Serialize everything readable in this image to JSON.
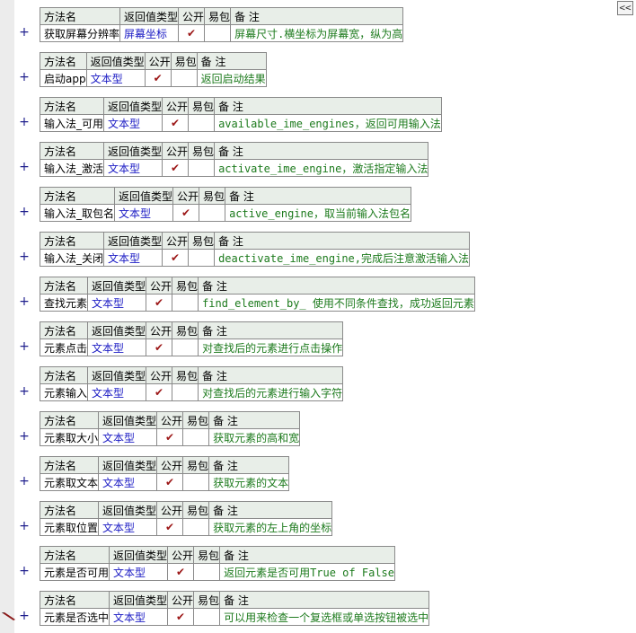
{
  "ui": {
    "collapse_label": "<<",
    "plus_label": "+",
    "check_mark": "✔"
  },
  "header": {
    "name": "方法名",
    "return_type": "返回值类型",
    "public": "公开",
    "easy_pack": "易包",
    "note": "备 注"
  },
  "methods": [
    {
      "name": "获取屏幕分辨率",
      "return_type": "屏幕坐标",
      "note": "屏幕尺寸.横坐标为屏幕宽，纵为高"
    },
    {
      "name": "启动app",
      "return_type": "文本型",
      "note": "返回启动结果"
    },
    {
      "name": "输入法_可用",
      "return_type": "文本型",
      "note": "available_ime_engines，返回可用输入法"
    },
    {
      "name": "输入法_激活",
      "return_type": "文本型",
      "note": "activate_ime_engine，激活指定输入法"
    },
    {
      "name": "输入法_取包名",
      "return_type": "文本型",
      "note": "active_engine，取当前输入法包名"
    },
    {
      "name": "输入法_关闭",
      "return_type": "文本型",
      "note": "deactivate_ime_engine,完成后注意激活输入法"
    },
    {
      "name": "查找元素",
      "return_type": "文本型",
      "note": "find_element_by_ 使用不同条件查找，成功返回元素"
    },
    {
      "name": "元素点击",
      "return_type": "文本型",
      "note": "对查找后的元素进行点击操作"
    },
    {
      "name": "元素输入",
      "return_type": "文本型",
      "note": "对查找后的元素进行输入字符"
    },
    {
      "name": "元素取大小",
      "return_type": "文本型",
      "note": "获取元素的高和宽"
    },
    {
      "name": "元素取文本",
      "return_type": "文本型",
      "note": "获取元素的文本"
    },
    {
      "name": "元素取位置",
      "return_type": "文本型",
      "note": "获取元素的左上角的坐标"
    },
    {
      "name": "元素是否可用",
      "return_type": "文本型",
      "note": "返回元素是否可用True of False"
    },
    {
      "name": "元素是否选中",
      "return_type": "文本型",
      "note": "可以用来检查一个复选框或单选按钮被选中"
    }
  ]
}
